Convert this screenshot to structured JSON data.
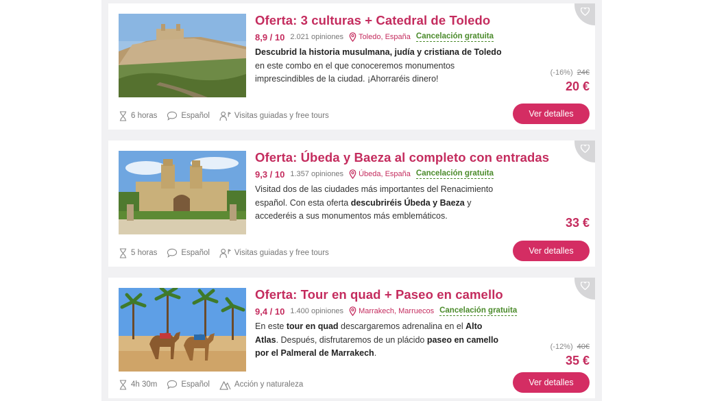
{
  "offers": [
    {
      "title": "Oferta: 3 culturas + Catedral de Toledo",
      "rating": "8,9 / 10",
      "opinions": "2.021 opiniones",
      "location": "Toledo, España",
      "cancellation": "Cancelación gratuita",
      "desc": [
        {
          "t": "Descubrid la historia musulmana, judía y cristiana de Toledo",
          "b": true
        },
        {
          "t": " en este combo en el que conoceremos monumentos imprescindibles de la ciudad. ¡Ahorraréis dinero!",
          "b": false
        }
      ],
      "discount": "(-16%)",
      "old_price": "24€",
      "price": "20 €",
      "duration": "6 horas",
      "language": "Español",
      "category": "Visitas guiadas y free tours",
      "category_icon": "guide-icon",
      "button": "Ver detalles"
    },
    {
      "title": "Oferta: Úbeda y Baeza al completo con entradas",
      "rating": "9,3 / 10",
      "opinions": "1.357 opiniones",
      "location": "Úbeda, España",
      "cancellation": "Cancelación gratuita",
      "desc": [
        {
          "t": "Visitad dos de las ciudades más importantes del Renacimiento español. Con esta oferta ",
          "b": false
        },
        {
          "t": "descubriréis Úbeda y Baeza",
          "b": true
        },
        {
          "t": " y accederéis a sus monumentos más emblemáticos.",
          "b": false
        }
      ],
      "discount": "",
      "old_price": "",
      "price": "33 €",
      "duration": "5 horas",
      "language": "Español",
      "category": "Visitas guiadas y free tours",
      "category_icon": "guide-icon",
      "button": "Ver detalles"
    },
    {
      "title": "Oferta: Tour en quad + Paseo en camello",
      "rating": "9,4 / 10",
      "opinions": "1.400 opiniones",
      "location": "Marrakech, Marruecos",
      "cancellation": "Cancelación gratuita",
      "desc": [
        {
          "t": "En este ",
          "b": false
        },
        {
          "t": "tour en quad",
          "b": true
        },
        {
          "t": " descargaremos adrenalina en el ",
          "b": false
        },
        {
          "t": "Alto Atlas",
          "b": true
        },
        {
          "t": ". Después, disfrutaremos de un plácido ",
          "b": false
        },
        {
          "t": "paseo en camello por el Palmeral de Marrakech",
          "b": true
        },
        {
          "t": ".",
          "b": false
        }
      ],
      "discount": "(-12%)",
      "old_price": "40€",
      "price": "35 €",
      "duration": "4h 30m",
      "language": "Español",
      "category": "Acción y naturaleza",
      "category_icon": "mountain-icon",
      "button": "Ver detalles"
    }
  ]
}
